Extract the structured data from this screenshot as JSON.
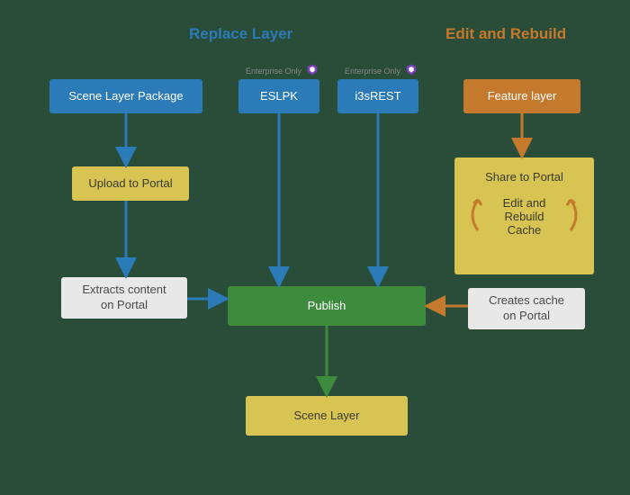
{
  "headings": {
    "replace": "Replace Layer",
    "edit": "Edit and Rebuild"
  },
  "nodes": {
    "slp": "Scene Layer Package",
    "eslpk": "ESLPK",
    "i3srest": "i3sREST",
    "feature_layer": "Feature layer",
    "upload_portal": "Upload to Portal",
    "share_portal": "Share to Portal",
    "edit_rebuild": "Edit and\nRebuild Cache",
    "extracts": "Extracts content\non Portal",
    "creates_cache": "Creates cache\non Portal",
    "publish": "Publish",
    "scene_layer": "Scene Layer"
  },
  "badges": {
    "enterprise": "Enterprise Only"
  },
  "colors": {
    "blue": "#2b7bb9",
    "yellow": "#d8c452",
    "grey": "#e8e8e8",
    "green": "#3d8b3d",
    "orange": "#c4792d",
    "purple": "#7b3fb8",
    "bg": "#2a4d3a"
  },
  "chart_data": {
    "type": "diagram",
    "title": "Scene Layer publishing workflows",
    "groups": [
      {
        "name": "Replace Layer",
        "color": "#2b7bb9"
      },
      {
        "name": "Edit and Rebuild",
        "color": "#c4792d"
      }
    ],
    "nodes": [
      {
        "id": "slp",
        "label": "Scene Layer Package",
        "group": "Replace Layer",
        "style": "blue"
      },
      {
        "id": "eslpk",
        "label": "ESLPK",
        "group": "Replace Layer",
        "style": "blue",
        "badge": "Enterprise Only"
      },
      {
        "id": "i3srest",
        "label": "i3sREST",
        "group": "Replace Layer",
        "style": "blue",
        "badge": "Enterprise Only"
      },
      {
        "id": "feature_layer",
        "label": "Feature layer",
        "group": "Edit and Rebuild",
        "style": "orange"
      },
      {
        "id": "upload_portal",
        "label": "Upload to Portal",
        "group": "Replace Layer",
        "style": "yellow"
      },
      {
        "id": "share_portal",
        "label": "Share to Portal",
        "group": "Edit and Rebuild",
        "style": "yellow"
      },
      {
        "id": "edit_rebuild",
        "label": "Edit and Rebuild Cache",
        "group": "Edit and Rebuild",
        "style": "yellow"
      },
      {
        "id": "extracts",
        "label": "Extracts content on Portal",
        "group": "Replace Layer",
        "style": "grey"
      },
      {
        "id": "creates_cache",
        "label": "Creates cache on Portal",
        "group": "Edit and Rebuild",
        "style": "grey"
      },
      {
        "id": "publish",
        "label": "Publish",
        "style": "green"
      },
      {
        "id": "scene_layer",
        "label": "Scene Layer",
        "style": "yellow"
      }
    ],
    "edges": [
      {
        "from": "slp",
        "to": "upload_portal",
        "color": "#2b7bb9"
      },
      {
        "from": "upload_portal",
        "to": "extracts",
        "color": "#2b7bb9"
      },
      {
        "from": "extracts",
        "to": "publish",
        "color": "#2b7bb9"
      },
      {
        "from": "eslpk",
        "to": "publish",
        "color": "#2b7bb9"
      },
      {
        "from": "i3srest",
        "to": "publish",
        "color": "#2b7bb9"
      },
      {
        "from": "feature_layer",
        "to": "share_portal",
        "color": "#c4792d"
      },
      {
        "from": "share_portal",
        "to": "edit_rebuild",
        "color": "#c4792d",
        "cycle": true
      },
      {
        "from": "creates_cache",
        "to": "publish",
        "color": "#c4792d"
      },
      {
        "from": "publish",
        "to": "scene_layer",
        "color": "#3d8b3d"
      }
    ]
  }
}
